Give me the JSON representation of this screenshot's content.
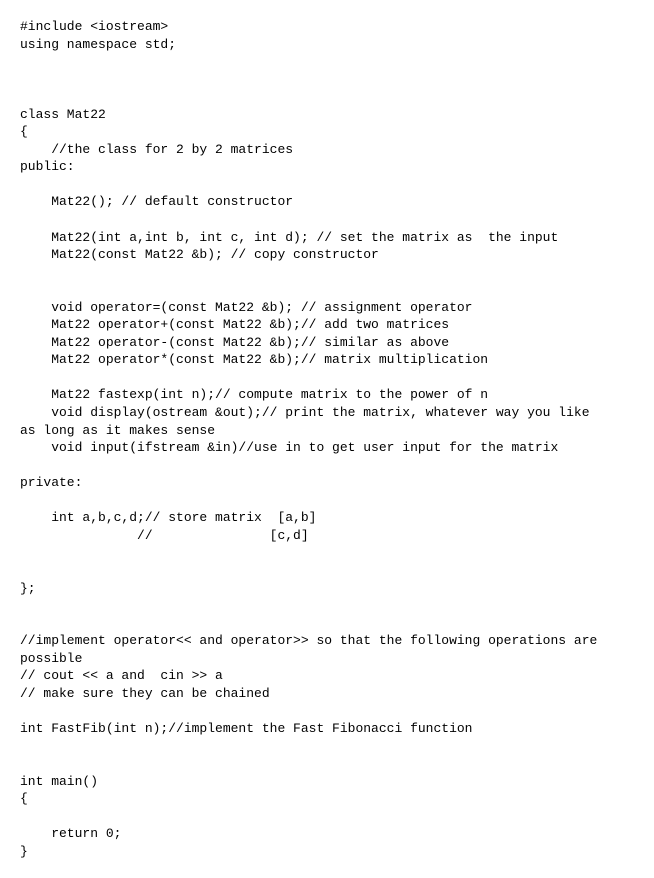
{
  "code": {
    "lines": [
      "#include <iostream>",
      "using namespace std;",
      "",
      "",
      "",
      "class Mat22",
      "{",
      "    //the class for 2 by 2 matrices",
      "public:",
      "",
      "    Mat22(); // default constructor",
      "",
      "    Mat22(int a,int b, int c, int d); // set the matrix as  the input",
      "    Mat22(const Mat22 &b); // copy constructor",
      "",
      "",
      "    void operator=(const Mat22 &b); // assignment operator",
      "    Mat22 operator+(const Mat22 &b);// add two matrices",
      "    Mat22 operator-(const Mat22 &b);// similar as above",
      "    Mat22 operator*(const Mat22 &b);// matrix multiplication",
      "",
      "    Mat22 fastexp(int n);// compute matrix to the power of n",
      "    void display(ostream &out);// print the matrix, whatever way you like",
      "as long as it makes sense",
      "    void input(ifstream &in)//use in to get user input for the matrix",
      "",
      "private:",
      "",
      "    int a,b,c,d;// store matrix  [a,b]",
      "               //               [c,d]",
      "",
      "",
      "};",
      "",
      "",
      "//implement operator<< and operator>> so that the following operations are",
      "possible",
      "// cout << a and  cin >> a",
      "// make sure they can be chained",
      "",
      "int FastFib(int n);//implement the Fast Fibonacci function",
      "",
      "",
      "int main()",
      "{",
      "",
      "    return 0;",
      "}"
    ]
  }
}
